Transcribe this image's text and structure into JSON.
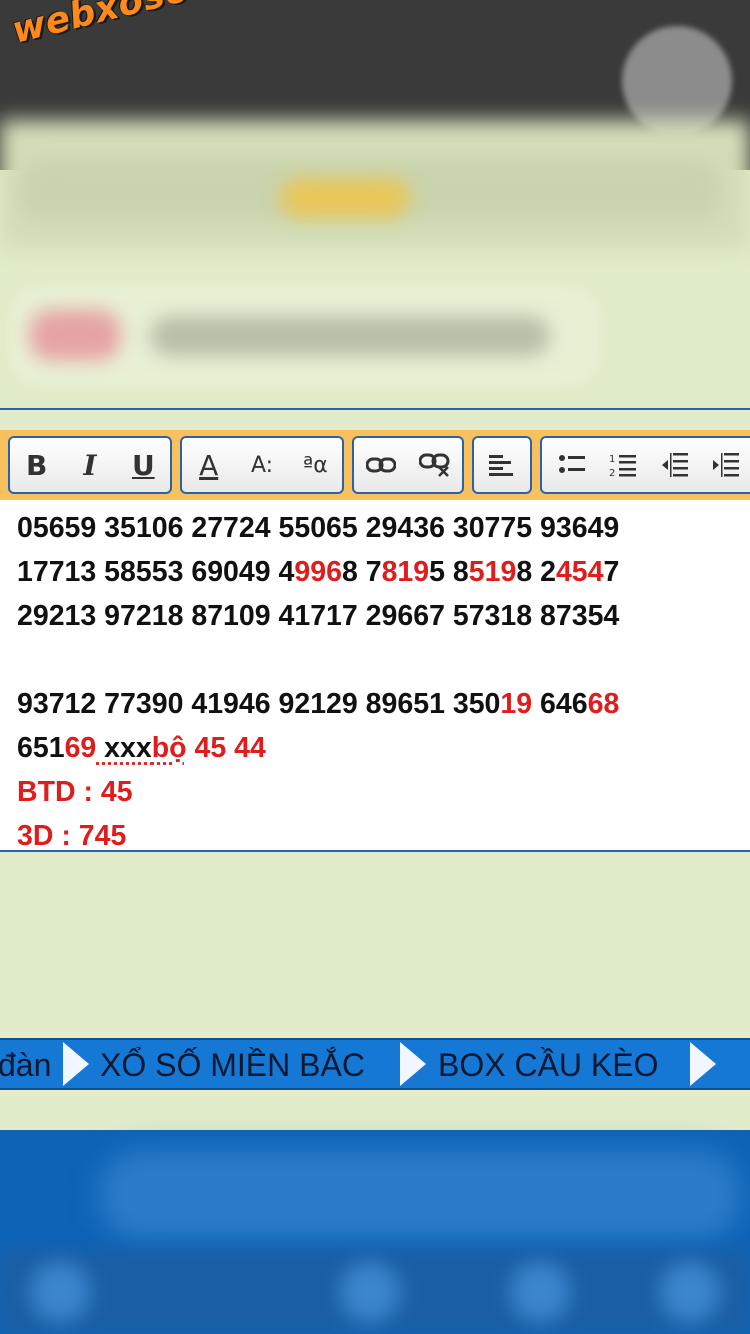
{
  "watermark": {
    "text": "webxoso.net",
    "color": "#ff8a1c"
  },
  "toolbar": {
    "groups": [
      {
        "buttons": [
          {
            "icon": "bold-icon",
            "glyph": "B"
          },
          {
            "icon": "italic-icon",
            "glyph": "I"
          },
          {
            "icon": "underline-icon",
            "glyph": "U"
          }
        ]
      },
      {
        "buttons": [
          {
            "icon": "font-color-icon",
            "glyph": "A"
          },
          {
            "icon": "font-size-icon",
            "glyph": "A:"
          },
          {
            "icon": "font-face-icon",
            "glyph": "ªα"
          }
        ]
      },
      {
        "buttons": [
          {
            "icon": "link-icon",
            "glyph": "⛓"
          },
          {
            "icon": "unlink-icon",
            "glyph": "⛓"
          }
        ]
      },
      {
        "buttons": [
          {
            "icon": "align-left-icon",
            "glyph": "≡"
          }
        ]
      },
      {
        "buttons": [
          {
            "icon": "bullet-list-icon",
            "glyph": "☰"
          },
          {
            "icon": "numbered-list-icon",
            "glyph": "☰"
          },
          {
            "icon": "outdent-icon",
            "glyph": "⇤"
          },
          {
            "icon": "indent-icon",
            "glyph": "⇥"
          }
        ]
      }
    ]
  },
  "editor": {
    "line1": "05659 35106 27724 55065 29436 30775 93649",
    "line2": {
      "a": "17713 58553 69049 4",
      "b": "996",
      "c": "8 7",
      "d": "819",
      "e": "5 8",
      "f": "519",
      "g": "8 2",
      "h": "454",
      "i": "7"
    },
    "line3": "29213 97218 87109 41717 29667 57318 87354",
    "line5": {
      "a": "93712 77390 41946 92129 89651 350",
      "b": "19",
      "c": " 646",
      "d": "68"
    },
    "line6": {
      "a": "651",
      "b": "69",
      "c": " xxx",
      "d": "bộ",
      "e": " 45 44"
    },
    "line7": "BTD : 45",
    "line8": "3D : 745",
    "accent_color": "#e01d1d"
  },
  "navbar": {
    "items": [
      "đàn",
      "XỔ SỐ MIỀN BẮC",
      "BOX CẦU KÈO"
    ],
    "background": "#1478d4"
  }
}
